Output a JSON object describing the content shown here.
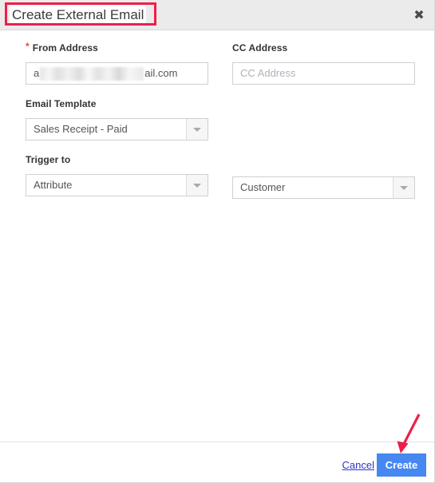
{
  "dialog": {
    "title": "Create External Email",
    "close_icon": "close-icon",
    "close_glyph": "✖"
  },
  "form": {
    "from_address": {
      "label": "From Address",
      "required_marker": "*",
      "required": true,
      "value_prefix": "a",
      "value_suffix": "ail.com",
      "redacted": true
    },
    "cc_address": {
      "label": "CC Address",
      "value": "",
      "placeholder": "CC Address"
    },
    "email_template": {
      "label": "Email Template",
      "value": "Sales Receipt - Paid",
      "arrow_icon": "chevron-down-icon"
    },
    "trigger_to": {
      "label": "Trigger to",
      "value": "Attribute",
      "arrow_icon": "chevron-down-icon"
    },
    "trigger_target": {
      "label": "",
      "value": "Customer",
      "arrow_icon": "chevron-down-icon"
    }
  },
  "footer": {
    "cancel_label": "Cancel",
    "create_label": "Create"
  },
  "annotations": {
    "title_highlight_color": "#ed1f49",
    "arrow_color": "#ed1f49"
  },
  "colors": {
    "header_background": "#ebebeb",
    "primary_button": "#4688f1",
    "link": "#3333cc",
    "required_star": "#e8453c",
    "input_border": "#d0d0d0",
    "label_text": "#333333"
  }
}
